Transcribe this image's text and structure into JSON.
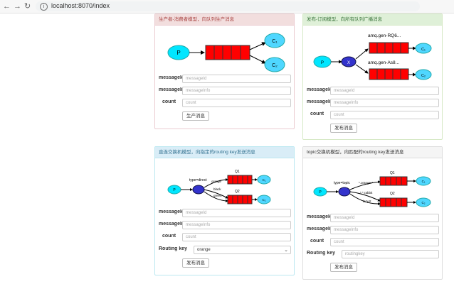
{
  "browser": {
    "url": "localhost:8070/index"
  },
  "panels": [
    {
      "title": "生产者-消费者模型，向队列生产消息",
      "diagram": {
        "producer": "P",
        "consumers": [
          "C₁",
          "C₂"
        ]
      },
      "fields": [
        {
          "label": "messageId",
          "placeholder": "messageId"
        },
        {
          "label": "messageInfo",
          "placeholder": "messageInfo"
        },
        {
          "label": "count",
          "placeholder": "count"
        }
      ],
      "button": "生产消息"
    },
    {
      "title": "发布-订阅模型，向所有队列广播消息",
      "diagram": {
        "producer": "P",
        "exchange": "X",
        "queues": [
          "amq.gen-RQ6...",
          "amq.gen-As8..."
        ],
        "consumers": [
          "C₁",
          "C₂"
        ]
      },
      "fields": [
        {
          "label": "messageId",
          "placeholder": "messageId"
        },
        {
          "label": "messageInfo",
          "placeholder": "messageInfo"
        },
        {
          "label": "count",
          "placeholder": "count"
        }
      ],
      "button": "发布消息"
    },
    {
      "title": "直连交换机模型，向指定的routing key发送消息",
      "diagram": {
        "producer": "P",
        "exchange_label": "type=direct",
        "routes": [
          "orange",
          "black",
          "green"
        ],
        "queues": [
          "Q1",
          "Q2"
        ],
        "consumers": [
          "C₁",
          "C₂"
        ]
      },
      "fields": [
        {
          "label": "messageId",
          "placeholder": "messageId"
        },
        {
          "label": "messageInfo",
          "placeholder": "messageInfo"
        },
        {
          "label": "count",
          "placeholder": "count"
        }
      ],
      "routing_key_label": "Routing key",
      "routing_key_value": "orange",
      "button": "发布消息"
    },
    {
      "title": "topic交换机模型，向匹配的routing key发送消息",
      "diagram": {
        "producer": "P",
        "exchange_label": "type=topic",
        "routes": [
          "*.orange.*",
          "*.*.rabbit",
          "lazy.#"
        ],
        "queues": [
          "Q1",
          "Q2"
        ],
        "consumers": [
          "C₁",
          "C₂"
        ]
      },
      "fields": [
        {
          "label": "messageId",
          "placeholder": "messageId"
        },
        {
          "label": "messageInfo",
          "placeholder": "messageInfo"
        },
        {
          "label": "count",
          "placeholder": "count"
        }
      ],
      "routing_key_label": "Routing key",
      "routing_key_placeholder": "routingkey",
      "button": "发布消息"
    }
  ]
}
